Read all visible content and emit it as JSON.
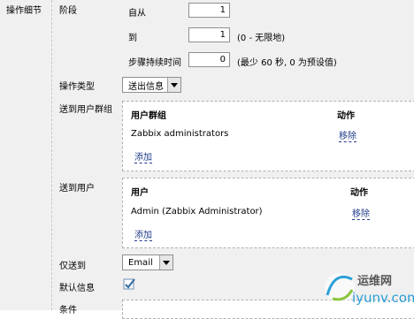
{
  "left": {
    "section_title": "操作细节"
  },
  "stage": {
    "label": "阶段",
    "from_label": "自从",
    "from_value": "1",
    "to_label": "到",
    "to_value": "1",
    "to_hint": "(0 - 无限地)",
    "step_label": "步骤持续时间",
    "step_value": "0",
    "step_hint": "(最少 60 秒, 0 为预设值)"
  },
  "operation_type": {
    "label": "操作类型",
    "value": "送出信息"
  },
  "user_groups": {
    "label": "送到用户群组",
    "col_name": "用户群组",
    "col_action": "动作",
    "rows": [
      {
        "name": "Zabbix administrators",
        "action": "移除"
      }
    ],
    "add_label": "添加"
  },
  "users": {
    "label": "送到用户",
    "col_name": "用户",
    "col_action": "动作",
    "rows": [
      {
        "name": "Admin (Zabbix Administrator)",
        "action": "移除"
      }
    ],
    "add_label": "添加"
  },
  "send_only_to": {
    "label": "仅送到",
    "value": "Email"
  },
  "default_message": {
    "label": "默认信息",
    "checked": true
  },
  "conditions": {
    "label": "条件"
  },
  "watermark": {
    "text_cn": "运维网",
    "text_url": "iyunv.com"
  }
}
